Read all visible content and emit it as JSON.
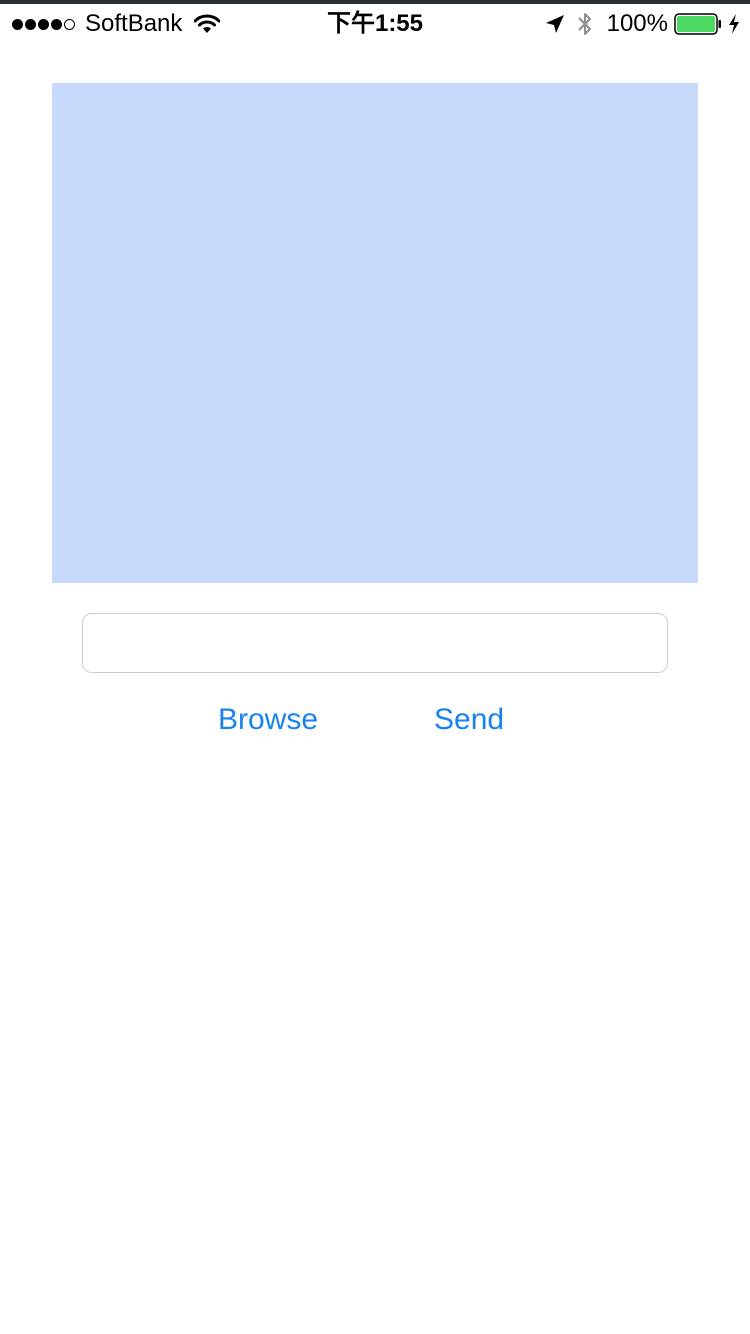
{
  "status_bar": {
    "carrier": "SoftBank",
    "time": "下午1:55",
    "battery_percent": "100%",
    "signal_bars_filled": 4,
    "signal_bars_total": 5,
    "battery_level": 1.0,
    "icons": [
      "wifi-icon",
      "location-arrow-icon",
      "bluetooth-icon",
      "battery-icon",
      "charging-icon"
    ]
  },
  "image_panel": {
    "color": "#c8dafb"
  },
  "input": {
    "value": "",
    "placeholder": ""
  },
  "actions": {
    "browse_label": "Browse",
    "send_label": "Send",
    "accent_color": "#1a82f0"
  }
}
